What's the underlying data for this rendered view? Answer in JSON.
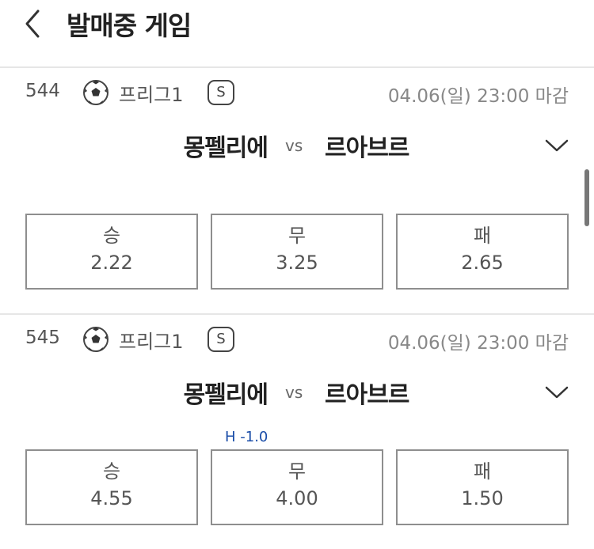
{
  "header": {
    "title": "발매중 게임",
    "back_icon": "chevron-left-icon"
  },
  "games": [
    {
      "number": "544",
      "sport_icon": "soccer-ball-icon",
      "league": "프리그1",
      "badge": "S",
      "deadline": "04.06(일) 23:00 마감",
      "home": "몽펠리에",
      "vs": "vs",
      "away": "르아브르",
      "handicap": "",
      "odds": [
        {
          "label": "승",
          "value": "2.22"
        },
        {
          "label": "무",
          "value": "3.25"
        },
        {
          "label": "패",
          "value": "2.65"
        }
      ]
    },
    {
      "number": "545",
      "sport_icon": "soccer-ball-icon",
      "league": "프리그1",
      "badge": "S",
      "deadline": "04.06(일) 23:00 마감",
      "home": "몽펠리에",
      "vs": "vs",
      "away": "르아브르",
      "handicap": "H -1.0",
      "odds": [
        {
          "label": "승",
          "value": "4.55"
        },
        {
          "label": "무",
          "value": "4.00"
        },
        {
          "label": "패",
          "value": "1.50"
        }
      ]
    }
  ],
  "colors": {
    "handicap": "#1a4da8",
    "border": "#8e8e8e",
    "divider": "#e6e6e6"
  }
}
